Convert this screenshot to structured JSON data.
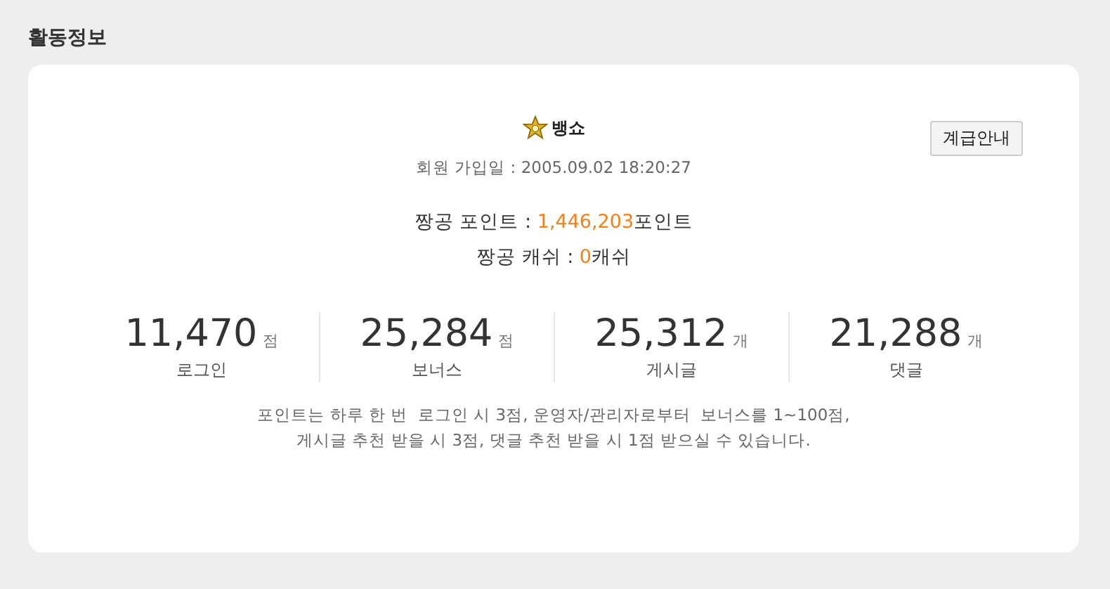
{
  "section_title": "활동정보",
  "profile": {
    "nickname": "뱅쇼",
    "join_label": "회원 가입일 : ",
    "join_date": "2005.09.02 18:20:27",
    "grade_button": "계급안내"
  },
  "balances": [
    {
      "label": "짱공 포인트 : ",
      "value": "1,446,203",
      "unit": "포인트"
    },
    {
      "label": "짱공 캐쉬 : ",
      "value": "0",
      "unit": "캐쉬"
    }
  ],
  "stats": [
    {
      "value": "11,470",
      "unit": "점",
      "label": "로그인"
    },
    {
      "value": "25,284",
      "unit": "점",
      "label": "보너스"
    },
    {
      "value": "25,312",
      "unit": "개",
      "label": "게시글"
    },
    {
      "value": "21,288",
      "unit": "개",
      "label": "댓글"
    }
  ],
  "note": [
    "포인트는 하루 한 번  로그인 시 3점, 운영자/관리자로부터  보너스를 1~100점,",
    "게시글 추천 받을 시 3점, 댓글 추천 받을 시 1점 받으실 수 있습니다."
  ]
}
